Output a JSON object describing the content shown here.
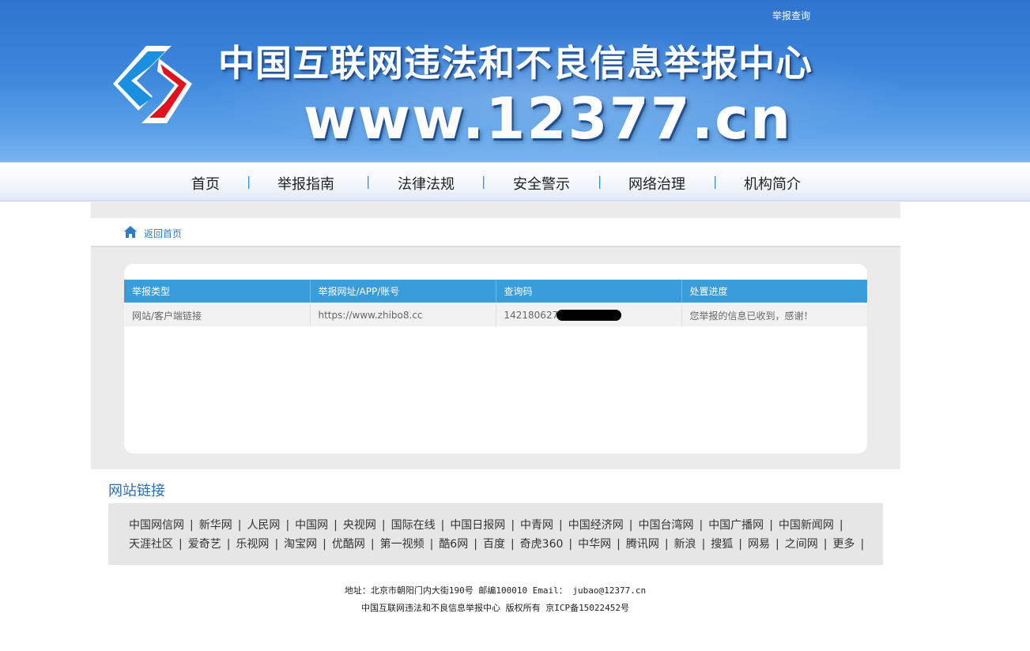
{
  "header": {
    "top_link": "举报查询",
    "title_cn": "中国互联网违法和不良信息举报中心",
    "title_url": "www.12377.cn",
    "colors": {
      "banner": "#3c86dc",
      "logo_blue": "#1a8fe0",
      "logo_red": "#e0121f"
    }
  },
  "nav": {
    "items": [
      "首页",
      "举报指南",
      "法律法规",
      "安全警示",
      "网络治理",
      "机构简介"
    ],
    "separator": "|"
  },
  "breadcrumb": {
    "icon": "home-icon",
    "label": "返回首页"
  },
  "results": {
    "headers": [
      "举报类型",
      "举报网址/APP/账号",
      "查询码",
      "处置进度"
    ],
    "row": {
      "type": "网站/客户端链接",
      "url": "https://www.zhibo8.cc",
      "code": "142180627",
      "status": "您举报的信息已收到，感谢！"
    },
    "colors": {
      "header_bg": "#3a9ddb"
    }
  },
  "links": {
    "title": "网站链接",
    "row1": [
      "中国网信网",
      "新华网",
      "人民网",
      "中国网",
      "央视网",
      "国际在线",
      "中国日报网",
      "中青网",
      "中国经济网",
      "中国台湾网",
      "中国广播网",
      "中国新闻网"
    ],
    "row2": [
      "天涯社区",
      "爱奇艺",
      "乐视网",
      "淘宝网",
      "优酷网",
      "第一视频",
      "酷6网",
      "百度",
      "奇虎360",
      "中华网",
      "腾讯网",
      "新浪",
      "搜狐",
      "网易",
      "之间网",
      "更多"
    ]
  },
  "footer": {
    "line1": "地址：北京市朝阳门内大街190号 邮编100010 Email： jubao@12377.cn",
    "line2": "中国互联网违法和不良信息举报中心 版权所有 京ICP备15022452号"
  }
}
